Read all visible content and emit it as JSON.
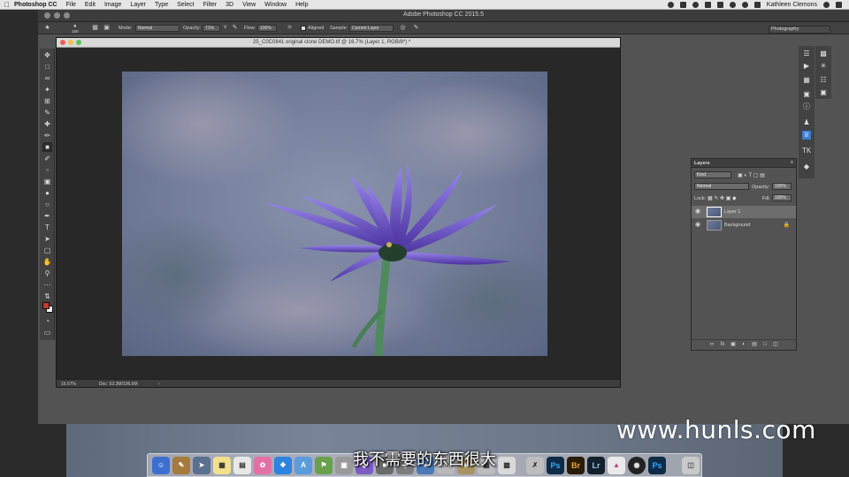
{
  "menubar": {
    "app_name": "Photoshop CC",
    "items": [
      "File",
      "Edit",
      "Image",
      "Layer",
      "Type",
      "Select",
      "Filter",
      "3D",
      "View",
      "Window",
      "Help"
    ],
    "user": "Kathleen Clemons"
  },
  "app_title": "Adobe Photoshop CC 2015.5",
  "options_bar": {
    "brush_size": "150",
    "mode_label": "Mode:",
    "mode_value": "Normal",
    "opacity_label": "Opacity:",
    "opacity_value": "71%",
    "flow_label": "Flow:",
    "flow_value": "100%",
    "aligned_label": "Aligned",
    "sample_label": "Sample:",
    "sample_value": "Current Layer"
  },
  "workspace": "Photography",
  "document": {
    "title": "25_C0C0841 original clone DEMO.tif @ 16.7% (Layer 1, RGB/8*) *",
    "zoom": "16.67%",
    "doc_size": "Doc: 53.3M/106.6M"
  },
  "layers_panel": {
    "title": "Layers",
    "filter_value": "Kind",
    "blend_mode": "Normal",
    "opacity_label": "Opacity:",
    "opacity_value": "100%",
    "lock_label": "Lock:",
    "fill_label": "Fill:",
    "fill_value": "100%",
    "layers": [
      {
        "name": "Layer 1",
        "selected": true
      },
      {
        "name": "Background",
        "selected": false,
        "locked": true
      }
    ]
  },
  "colors": {
    "foreground": "#c0392b",
    "background": "#ffffff"
  },
  "watermark": "www.hunls.com",
  "subtitle": "我不需要的东西很大"
}
